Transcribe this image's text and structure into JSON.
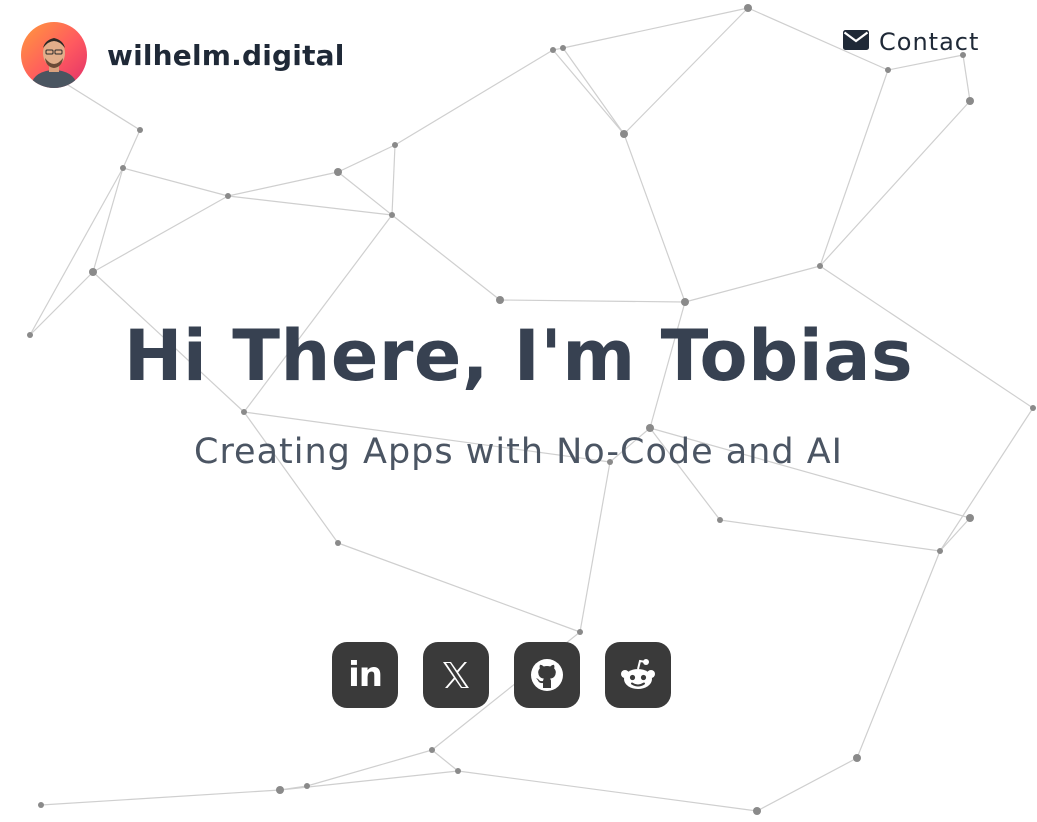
{
  "header": {
    "brand": "wilhelm.digital",
    "contact_label": "Contact"
  },
  "hero": {
    "title": "Hi There, I'm Tobias",
    "subtitle": "Creating Apps with No-Code and AI"
  },
  "socials": {
    "linkedin_text": "in",
    "items": [
      "linkedin",
      "x",
      "github",
      "reddit"
    ]
  },
  "icons": {
    "contact": "envelope-icon",
    "linkedin": "linkedin-icon",
    "x": "x-icon",
    "github": "github-icon",
    "reddit": "reddit-icon"
  },
  "colors": {
    "text_dark": "#1f2937",
    "hero_title": "#374151",
    "hero_sub": "#4b5563",
    "social_bg": "#3a3a3a",
    "network_line": "#cfcfcf",
    "network_node": "#8a8a8a",
    "avatar_gradient": [
      "#ff9a3c",
      "#ff5a5f",
      "#e0306a"
    ]
  }
}
